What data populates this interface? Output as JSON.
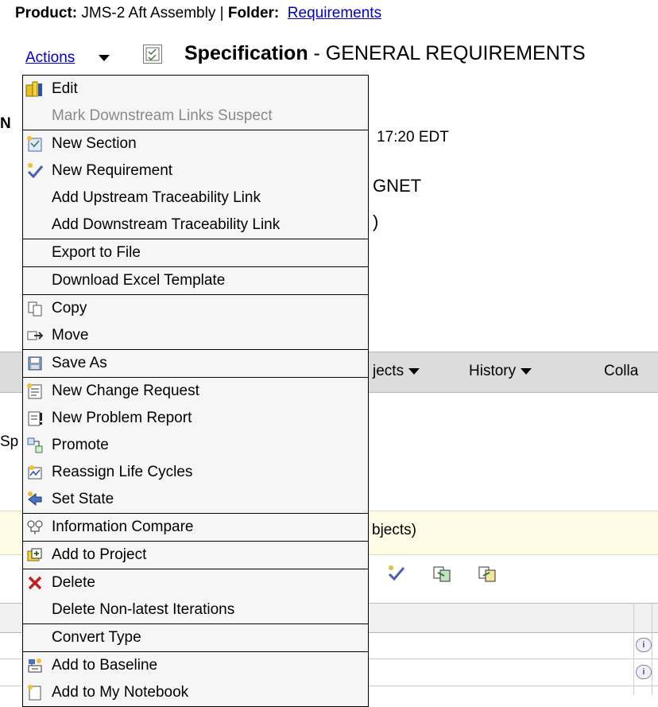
{
  "header": {
    "product_label": "Product:",
    "product_value": "JMS-2 Aft Assembly",
    "separator": "|",
    "folder_label": "Folder:",
    "folder_link": "Requirements"
  },
  "actions": {
    "label": "Actions",
    "spec_bold": "Specification",
    "spec_rest": " - GENERAL REQUIREMENTS"
  },
  "background": {
    "time_text": "17:20 EDT",
    "snet_text": "GNET",
    "paren_text": ")",
    "m_text": "N",
    "sp_text": "Sp",
    "objects_text": "bjects)"
  },
  "tabs": [
    {
      "label": "jects"
    },
    {
      "label": "History"
    },
    {
      "label": "Colla"
    }
  ],
  "menu": {
    "sections": [
      {
        "items": [
          {
            "label": "Edit",
            "icon": "edit-icon",
            "disabled": false
          },
          {
            "label": "Mark Downstream Links Suspect",
            "icon": "",
            "disabled": true
          }
        ]
      },
      {
        "items": [
          {
            "label": "New Section",
            "icon": "new-section-icon",
            "disabled": false
          },
          {
            "label": "New Requirement",
            "icon": "new-requirement-icon",
            "disabled": false
          },
          {
            "label": "Add Upstream Traceability Link",
            "icon": "",
            "disabled": false
          },
          {
            "label": "Add Downstream Traceability Link",
            "icon": "",
            "disabled": false
          }
        ]
      },
      {
        "items": [
          {
            "label": "Export to File",
            "icon": "",
            "disabled": false
          }
        ]
      },
      {
        "items": [
          {
            "label": "Download Excel Template",
            "icon": "",
            "disabled": false
          }
        ]
      },
      {
        "items": [
          {
            "label": "Copy",
            "icon": "copy-icon",
            "disabled": false
          },
          {
            "label": "Move",
            "icon": "move-icon",
            "disabled": false
          }
        ]
      },
      {
        "items": [
          {
            "label": "Save As",
            "icon": "save-as-icon",
            "disabled": false
          }
        ]
      },
      {
        "items": [
          {
            "label": "New Change Request",
            "icon": "change-request-icon",
            "disabled": false
          },
          {
            "label": "New Problem Report",
            "icon": "problem-report-icon",
            "disabled": false
          },
          {
            "label": "Promote",
            "icon": "promote-icon",
            "disabled": false
          },
          {
            "label": "Reassign Life Cycles",
            "icon": "life-cycle-icon",
            "disabled": false
          },
          {
            "label": "Set State",
            "icon": "set-state-icon",
            "disabled": false
          }
        ]
      },
      {
        "items": [
          {
            "label": "Information Compare",
            "icon": "compare-icon",
            "disabled": false
          }
        ]
      },
      {
        "items": [
          {
            "label": "Add to Project",
            "icon": "add-project-icon",
            "disabled": false
          }
        ]
      },
      {
        "items": [
          {
            "label": "Delete",
            "icon": "delete-icon",
            "disabled": false
          },
          {
            "label": "Delete Non-latest Iterations",
            "icon": "",
            "disabled": false
          }
        ]
      },
      {
        "items": [
          {
            "label": "Convert Type",
            "icon": "",
            "disabled": false
          }
        ]
      },
      {
        "items": [
          {
            "label": "Add to Baseline",
            "icon": "baseline-icon",
            "disabled": false
          },
          {
            "label": "Add to My Notebook",
            "icon": "notebook-icon",
            "disabled": false
          }
        ]
      }
    ]
  }
}
